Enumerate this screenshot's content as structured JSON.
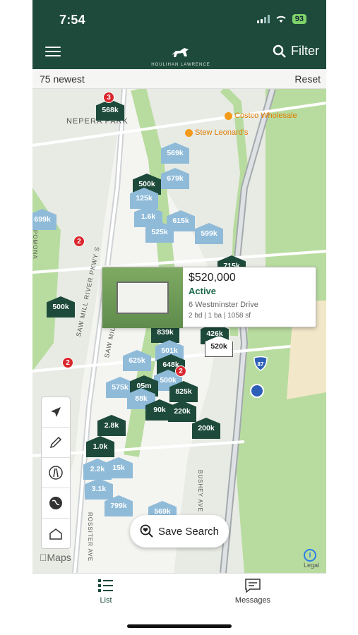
{
  "status": {
    "time": "7:54",
    "battery": "93"
  },
  "header": {
    "brand": "HOULIHAN LAWRENCE",
    "filter_label": "Filter"
  },
  "subbar": {
    "count_label": "75 newest",
    "reset_label": "Reset"
  },
  "map": {
    "labels": {
      "neighborhood": "NEPERA PARK",
      "street1": "SAW MILL RIVER PKWY S",
      "street2": "SAW MILL RIVER",
      "street3": "BUSHEY AVE",
      "street4": "ROSSITER AVE",
      "street5": "POMONA"
    },
    "pois": {
      "costco": "Costco Wholesale",
      "stewleonards": "Stew Leonard's"
    },
    "highway_shield": "87",
    "pins": [
      {
        "label": "568k",
        "style": "dark"
      },
      {
        "label": "569k",
        "style": "light"
      },
      {
        "label": "679k",
        "style": "light"
      },
      {
        "label": "500k",
        "style": "dark"
      },
      {
        "label": "125k",
        "style": "light"
      },
      {
        "label": "699k",
        "style": "light"
      },
      {
        "label": "1.6k",
        "style": "light"
      },
      {
        "label": "615k",
        "style": "light"
      },
      {
        "label": "525k",
        "style": "light"
      },
      {
        "label": "599k",
        "style": "light"
      },
      {
        "label": "715k",
        "style": "dark"
      },
      {
        "label": "500k",
        "style": "dark"
      },
      {
        "label": "839k",
        "style": "dark"
      },
      {
        "label": "426k",
        "style": "dark"
      },
      {
        "label": "520k",
        "style": "white"
      },
      {
        "label": "501k",
        "style": "light"
      },
      {
        "label": "625k",
        "style": "light"
      },
      {
        "label": "648k",
        "style": "dark"
      },
      {
        "label": "500k",
        "style": "light"
      },
      {
        "label": "575k",
        "style": "light"
      },
      {
        "label": "05m",
        "style": "dark"
      },
      {
        "label": "825k",
        "style": "dark"
      },
      {
        "label": "88k",
        "style": "light"
      },
      {
        "label": "90k",
        "style": "dark"
      },
      {
        "label": "220k",
        "style": "dark"
      },
      {
        "label": "2.8k",
        "style": "dark"
      },
      {
        "label": "200k",
        "style": "dark"
      },
      {
        "label": "1.0k",
        "style": "dark"
      },
      {
        "label": "2.2k",
        "style": "light"
      },
      {
        "label": "15k",
        "style": "light"
      },
      {
        "label": "3.1k",
        "style": "light"
      },
      {
        "label": "799k",
        "style": "light"
      },
      {
        "label": "569k",
        "style": "light"
      }
    ],
    "clusters": [
      "3",
      "2",
      "2",
      "2"
    ]
  },
  "popup": {
    "price": "$520,000",
    "status": "Active",
    "address": "6 Westminster Drive",
    "details": "2 bd | 1 ba | 1058 sf"
  },
  "toolbar": {
    "items": [
      {
        "icon": "location-arrow-icon"
      },
      {
        "icon": "draw-pencil-icon"
      },
      {
        "icon": "road-icon"
      },
      {
        "icon": "globe-icon"
      },
      {
        "icon": "3d-house-icon"
      }
    ]
  },
  "save_search": {
    "label": "Save Search"
  },
  "attribution": {
    "maps": "Maps",
    "legal": "Legal"
  },
  "tabs": {
    "list_label": "List",
    "messages_label": "Messages"
  }
}
